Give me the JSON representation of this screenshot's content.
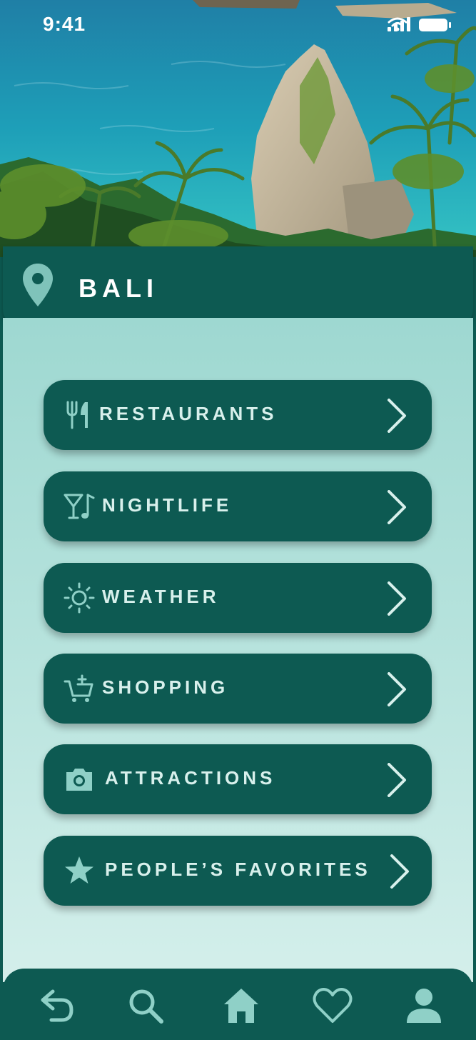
{
  "status": {
    "time": "9:41"
  },
  "location": {
    "name": "BALI",
    "icon": "map-pin-icon"
  },
  "menu": [
    {
      "label": "RESTAURANTS",
      "icon": "fork-knife-icon"
    },
    {
      "label": "NIGHTLIFE",
      "icon": "cocktail-music-icon"
    },
    {
      "label": "WEATHER",
      "icon": "sun-icon"
    },
    {
      "label": "SHOPPING",
      "icon": "cart-add-icon"
    },
    {
      "label": "ATTRACTIONS",
      "icon": "camera-icon"
    },
    {
      "label": "PEOPLE’S FAVORITES",
      "icon": "star-icon"
    }
  ],
  "nav": [
    "back-icon",
    "search-icon",
    "home-icon",
    "heart-icon",
    "profile-icon"
  ],
  "colors": {
    "primary": "#0d5a52",
    "accent": "#8fd0c7",
    "label": "#d8f0ec"
  }
}
